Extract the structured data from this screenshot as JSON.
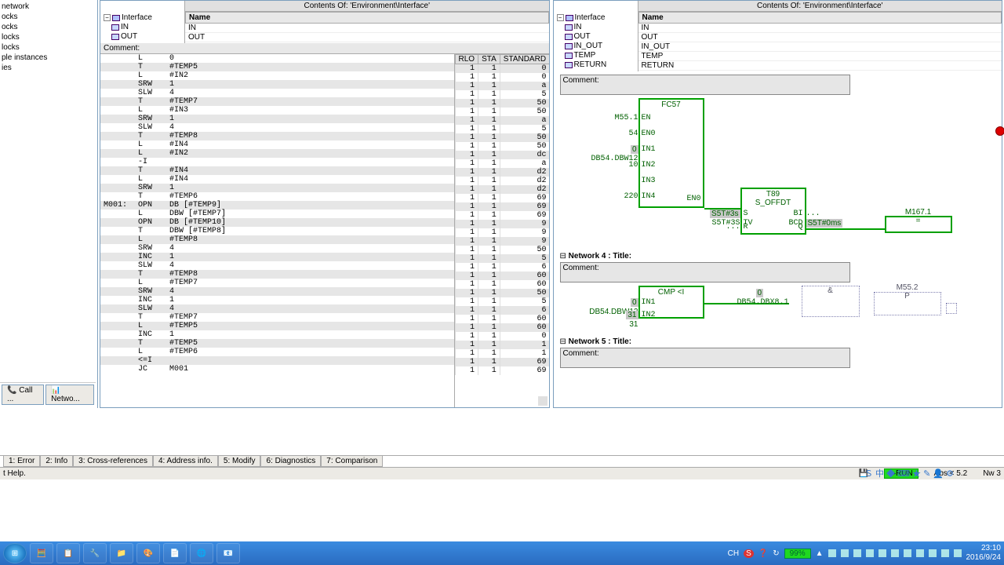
{
  "sidebar": {
    "items": [
      "network",
      "ocks",
      "ocks",
      "locks",
      "locks",
      "ple instances",
      "ies"
    ],
    "tabs": {
      "call": "Call ...",
      "netw": "Netwo..."
    }
  },
  "pane_left": {
    "contents_of": "Contents Of: 'Environment\\Interface'",
    "tree_root": "Interface",
    "tree_children": [
      "IN",
      "OUT"
    ],
    "name_header": "Name",
    "name_rows": [
      "IN",
      "OUT"
    ],
    "comment_label": "Comment:",
    "cols": {
      "rlo": "RLO",
      "sta": "STA",
      "standard": "STANDARD"
    },
    "stl": [
      {
        "lbl": "",
        "op": "L",
        "arg": "0",
        "r": "1",
        "s": "1",
        "v": "0"
      },
      {
        "lbl": "",
        "op": "T",
        "arg": "#TEMP5",
        "r": "1",
        "s": "1",
        "v": "0"
      },
      {
        "lbl": "",
        "op": "L",
        "arg": "#IN2",
        "r": "1",
        "s": "1",
        "v": "a"
      },
      {
        "lbl": "",
        "op": "SRW",
        "arg": "1",
        "r": "1",
        "s": "1",
        "v": "5"
      },
      {
        "lbl": "",
        "op": "SLW",
        "arg": "4",
        "r": "1",
        "s": "1",
        "v": "50"
      },
      {
        "lbl": "",
        "op": "T",
        "arg": "#TEMP7",
        "r": "1",
        "s": "1",
        "v": "50"
      },
      {
        "lbl": "",
        "op": "L",
        "arg": "#IN3",
        "r": "1",
        "s": "1",
        "v": "a"
      },
      {
        "lbl": "",
        "op": "SRW",
        "arg": "1",
        "r": "1",
        "s": "1",
        "v": "5"
      },
      {
        "lbl": "",
        "op": "SLW",
        "arg": "4",
        "r": "1",
        "s": "1",
        "v": "50"
      },
      {
        "lbl": "",
        "op": "T",
        "arg": "#TEMP8",
        "r": "1",
        "s": "1",
        "v": "50"
      },
      {
        "lbl": "",
        "op": "L",
        "arg": "#IN4",
        "r": "1",
        "s": "1",
        "v": "dc"
      },
      {
        "lbl": "",
        "op": "L",
        "arg": "#IN2",
        "r": "1",
        "s": "1",
        "v": "a"
      },
      {
        "lbl": "",
        "op": "-I",
        "arg": "",
        "r": "1",
        "s": "1",
        "v": "d2"
      },
      {
        "lbl": "",
        "op": "T",
        "arg": "#IN4",
        "r": "1",
        "s": "1",
        "v": "d2"
      },
      {
        "lbl": "",
        "op": "L",
        "arg": "#IN4",
        "r": "1",
        "s": "1",
        "v": "d2"
      },
      {
        "lbl": "",
        "op": "SRW",
        "arg": "1",
        "r": "1",
        "s": "1",
        "v": "69"
      },
      {
        "lbl": "",
        "op": "T",
        "arg": "#TEMP6",
        "r": "1",
        "s": "1",
        "v": "69"
      },
      {
        "lbl": "M001:",
        "op": "OPN",
        "arg": "DB [#TEMP9]",
        "r": "1",
        "s": "1",
        "v": "69"
      },
      {
        "lbl": "",
        "op": "L",
        "arg": "DBW [#TEMP7]",
        "r": "1",
        "s": "1",
        "v": "9"
      },
      {
        "lbl": "",
        "op": "OPN",
        "arg": "DB [#TEMP10]",
        "r": "1",
        "s": "1",
        "v": "9"
      },
      {
        "lbl": "",
        "op": "T",
        "arg": "DBW [#TEMP8]",
        "r": "1",
        "s": "1",
        "v": "9"
      },
      {
        "lbl": "",
        "op": "L",
        "arg": "#TEMP8",
        "r": "1",
        "s": "1",
        "v": "50"
      },
      {
        "lbl": "",
        "op": "SRW",
        "arg": "4",
        "r": "1",
        "s": "1",
        "v": "5"
      },
      {
        "lbl": "",
        "op": "INC",
        "arg": "1",
        "r": "1",
        "s": "1",
        "v": "6"
      },
      {
        "lbl": "",
        "op": "SLW",
        "arg": "4",
        "r": "1",
        "s": "1",
        "v": "60"
      },
      {
        "lbl": "",
        "op": "T",
        "arg": "#TEMP8",
        "r": "1",
        "s": "1",
        "v": "60"
      },
      {
        "lbl": "",
        "op": "L",
        "arg": "#TEMP7",
        "r": "1",
        "s": "1",
        "v": "50"
      },
      {
        "lbl": "",
        "op": "SRW",
        "arg": "4",
        "r": "1",
        "s": "1",
        "v": "5"
      },
      {
        "lbl": "",
        "op": "INC",
        "arg": "1",
        "r": "1",
        "s": "1",
        "v": "6"
      },
      {
        "lbl": "",
        "op": "SLW",
        "arg": "4",
        "r": "1",
        "s": "1",
        "v": "60"
      },
      {
        "lbl": "",
        "op": "T",
        "arg": "#TEMP7",
        "r": "1",
        "s": "1",
        "v": "60"
      },
      {
        "lbl": "",
        "op": "L",
        "arg": "#TEMP5",
        "r": "1",
        "s": "1",
        "v": "0"
      },
      {
        "lbl": "",
        "op": "INC",
        "arg": "1",
        "r": "1",
        "s": "1",
        "v": "1"
      },
      {
        "lbl": "",
        "op": "T",
        "arg": "#TEMP5",
        "r": "1",
        "s": "1",
        "v": "1"
      },
      {
        "lbl": "",
        "op": "L",
        "arg": "#TEMP6",
        "r": "1",
        "s": "1",
        "v": "69"
      },
      {
        "lbl": "",
        "op": "<=I",
        "arg": "",
        "r": "1",
        "s": "1",
        "v": "69"
      },
      {
        "lbl": "",
        "op": "JC",
        "arg": "M001",
        "r": "",
        "s": "",
        "v": ""
      }
    ]
  },
  "pane_right": {
    "contents_of": "Contents Of: 'Environment\\Interface'",
    "tree_root": "Interface",
    "tree_children": [
      "IN",
      "OUT",
      "IN_OUT",
      "TEMP",
      "RETURN"
    ],
    "name_header": "Name",
    "name_rows": [
      "IN",
      "OUT",
      "IN_OUT",
      "TEMP",
      "RETURN"
    ],
    "comment_label": "Comment:",
    "network4": "Network 4 : Title:",
    "network5": "Network 5 : Title:",
    "fc57": {
      "name": "FC57",
      "pins_left": [
        {
          "lbl": "M55.1",
          "pin": "EN",
          "shade": false
        },
        {
          "lbl": "54",
          "pin": "EN0",
          "shade": false
        },
        {
          "lbl": "0",
          "pin": "IN1",
          "shade": true,
          "sub": "DB54.DBW12"
        },
        {
          "lbl": "10",
          "pin": "IN2",
          "shade": false
        },
        {
          "lbl": "",
          "pin": "IN3",
          "shade": false
        },
        {
          "lbl": "220",
          "pin": "IN4",
          "shade": false
        }
      ],
      "pin_right": "EN0"
    },
    "t89": {
      "name": "T89",
      "type": "S_OFFDT",
      "s_lbl": "S5T#3s",
      "s_pin": "S",
      "bi_pin": "BI",
      "bi_val": "...",
      "tv_lbl": "S5T#3S",
      "tv_pin": "TV",
      "bcd_pin": "BCD",
      "bcd_val": "S5T#0ms",
      "r_lbl": "...",
      "r_pin": "R",
      "q_pin": "Q"
    },
    "coil1": {
      "name": "M167.1",
      "sym": "="
    },
    "cmp": {
      "type": "CMP <I",
      "in1_lbl": "0",
      "in1_sub": "DB54.DBW12",
      "in1": "IN1",
      "in2_lbl": "31",
      "in2_sub": "31",
      "in2": "IN2"
    },
    "dbx": {
      "lbl": "0",
      "sub": "DB54.DBX8.1"
    },
    "andblock": {
      "sym": "&"
    },
    "coil2": {
      "name": "M55.2",
      "sym": "P"
    }
  },
  "bottom_tabs": [
    "1: Error",
    "2: Info",
    "3: Cross-references",
    "4: Address info.",
    "5: Modify",
    "6: Diagnostics",
    "7: Comparison"
  ],
  "statusbar": {
    "help": "t Help.",
    "run": "RUN",
    "abs": "Abs < 5.2",
    "nw": "Nw 3"
  },
  "taskbar": {
    "battery": "99%",
    "time": "23:10",
    "date": "2016/9/24"
  }
}
